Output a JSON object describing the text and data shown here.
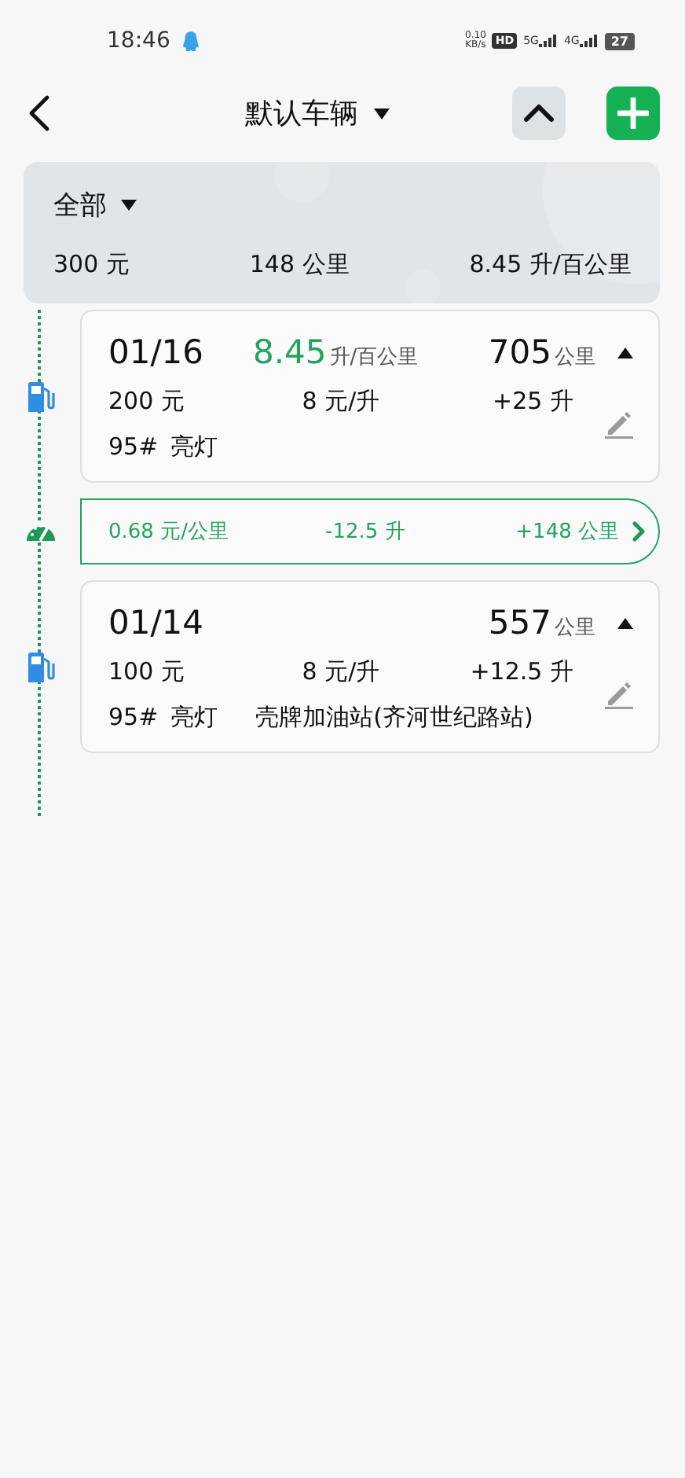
{
  "status_bar": {
    "time": "18:46",
    "net_speed_value": "0.10",
    "net_speed_unit": "KB/s",
    "hd": "HD",
    "sim_labels": [
      "5G",
      "4G"
    ],
    "battery": "27"
  },
  "header": {
    "title": "默认车辆"
  },
  "summary": {
    "filter": "全部",
    "cost": "300 元",
    "distance": "148 公里",
    "consumption": "8.45 升/百公里"
  },
  "timeline": [
    {
      "kind": "fill",
      "date": "01/16",
      "consumption": "8.45",
      "consumption_unit": "升/百公里",
      "odometer": "705",
      "odometer_unit": "公里",
      "amount": "200 元",
      "price": "8 元/升",
      "liters": "+25 升",
      "fuel": "95#",
      "light": "亮灯"
    },
    {
      "kind": "trip",
      "cost_per_km": "0.68 元/公里",
      "fuel_used": "-12.5 升",
      "distance": "+148 公里"
    },
    {
      "kind": "fill",
      "date": "01/14",
      "odometer": "557",
      "odometer_unit": "公里",
      "amount": "100 元",
      "price": "8 元/升",
      "liters": "+12.5 升",
      "fuel": "95#",
      "light": "亮灯",
      "station": "壳牌加油站(齐河世纪路站)"
    }
  ]
}
